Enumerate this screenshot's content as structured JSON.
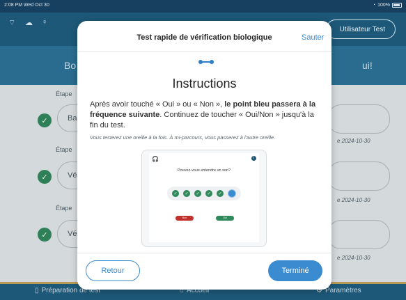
{
  "status_bar": {
    "time": "2:08 PM  Wed Oct 30",
    "battery": "100%"
  },
  "header": {
    "user_button": "Utilisateur Test",
    "greet_left": "Bo",
    "greet_right": "ui!"
  },
  "steps": [
    {
      "label": "Étape",
      "pill_text": "Ba",
      "date": "e 2024-10-30"
    },
    {
      "label": "Étape",
      "pill_text": "Vé",
      "date": "e 2024-10-30"
    },
    {
      "label": "Étape",
      "pill_text": "Vé",
      "date": "e 2024-10-30"
    }
  ],
  "bottom_nav": {
    "prep": "Préparation de test",
    "home": "Accueil",
    "settings": "Paramètres"
  },
  "modal": {
    "title": "Test rapide de vérification biologique",
    "skip": "Sauter",
    "heading": "Instructions",
    "text_part1": "Après avoir touché « Oui » ou « Non », ",
    "text_bold1": "le point bleu passera à la fréquence suivante",
    "text_part2": ". Continuez de toucher « Oui/Non » jusqu'à la fin du test.",
    "note": "Vous testerez une oreille à la fois. À mi-parcours, vous passerez à l'autre oreille.",
    "back": "Retour",
    "done": "Terminé"
  },
  "preview": {
    "question": "Pouvez-vous entendre un son?",
    "no": "Non",
    "yes": "Oui"
  },
  "colors": {
    "primary": "#1d5878",
    "accent": "#3a8bd0",
    "success": "#2f7f58",
    "danger": "#c0302a"
  }
}
